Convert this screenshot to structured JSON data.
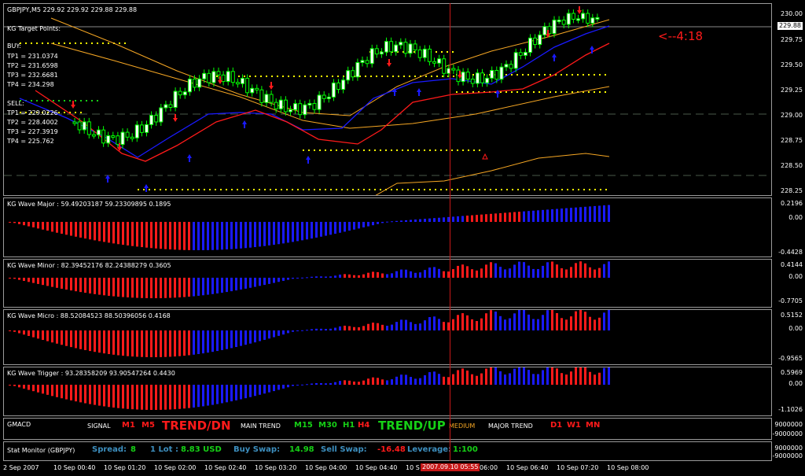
{
  "colors": {
    "bull": "#ffffff",
    "bear": "#00ff00",
    "blue": "#1a1aff",
    "red": "#ff1a1a",
    "orange": "#f5a623",
    "yellow": "#ffff00",
    "green": "#16d016",
    "grid": "#4a5a4a",
    "cursor": "#c81818"
  },
  "chart": {
    "title": "GBPJPY,M5  229.92 229.92 229.88 229.88",
    "price_ticks": [
      "230.00",
      "229.75",
      "229.50",
      "229.25",
      "229.00",
      "228.75",
      "228.50",
      "228.25"
    ],
    "current_price": "229.88",
    "timer": "<--4:18",
    "target_points": {
      "heading": "KG Target Points:",
      "buy_label": "BUY:",
      "buy": [
        "TP1 = 231.0374",
        "TP2 = 231.6598",
        "TP3 = 232.6681",
        "TP4 = 234.298"
      ],
      "sell_label": "SELL:",
      "sell": [
        "TP1 = 229.0226",
        "TP2 = 228.4002",
        "TP3 = 227.3919",
        "TP4 = 225.762"
      ]
    }
  },
  "indicators": [
    {
      "label": "KG Wave Major : 59.49203187 59.23309895 0.1895",
      "ticks": [
        "0.2196",
        "0.00",
        "-0.4428"
      ]
    },
    {
      "label": "KG Wave Minor : 82.39452176 82.24388279 0.3605",
      "ticks": [
        "0.4144",
        "0.00",
        "-0.7705"
      ]
    },
    {
      "label": "KG Wave Micro : 88.52084523 88.50396056 0.4168",
      "ticks": [
        "0.5152",
        "0.00",
        "-0.9565"
      ]
    },
    {
      "label": "KG Wave Trigger : 93.28358209 93.90547264 0.4430",
      "ticks": [
        "0.5969",
        "0.00",
        "-1.1026"
      ]
    }
  ],
  "gmacd": {
    "label": "GMACD",
    "signal_label": "SIGNAL",
    "signal_m1": "M1",
    "signal_m5": "M5",
    "signal_trend": "TREND/DN",
    "main_label": "MAIN TREND",
    "main_m15": "M15",
    "main_m30": "M30",
    "main_h1": "H1",
    "main_h4": "H4",
    "main_trend": "TREND/UP",
    "medium": "MEDIUM",
    "major_label": "MAJOR TREND",
    "major_d1": "D1",
    "major_w1": "W1",
    "major_mn": "MN",
    "ticks": [
      "9000000",
      "-9000000"
    ]
  },
  "stat": {
    "label": "Stat Monitor (GBPJPY)",
    "spread_label": "Spread:",
    "spread": "8",
    "lot_label": "1 Lot :",
    "lot": "8.83 USD",
    "buy_swap_label": "Buy Swap:",
    "buy_swap": "14.98",
    "sell_swap_label": "Sell Swap:",
    "sell_swap": "-16.48",
    "leverage_label": "Leverage:",
    "leverage": "1:100",
    "ticks": [
      "9000000",
      "-9000000"
    ]
  },
  "time_axis": [
    "2 Sep 2007",
    "10 Sep 00:40",
    "10 Sep 01:20",
    "10 Sep 02:00",
    "10 Sep 02:40",
    "10 Sep 03:20",
    "10 Sep 04:00",
    "10 Sep 04:40",
    "10 S",
    "06:00",
    "10 Sep 06:40",
    "10 Sep 07:20",
    "10 Sep 08:00"
  ],
  "cursor_time": "2007.09.10 05:55"
}
